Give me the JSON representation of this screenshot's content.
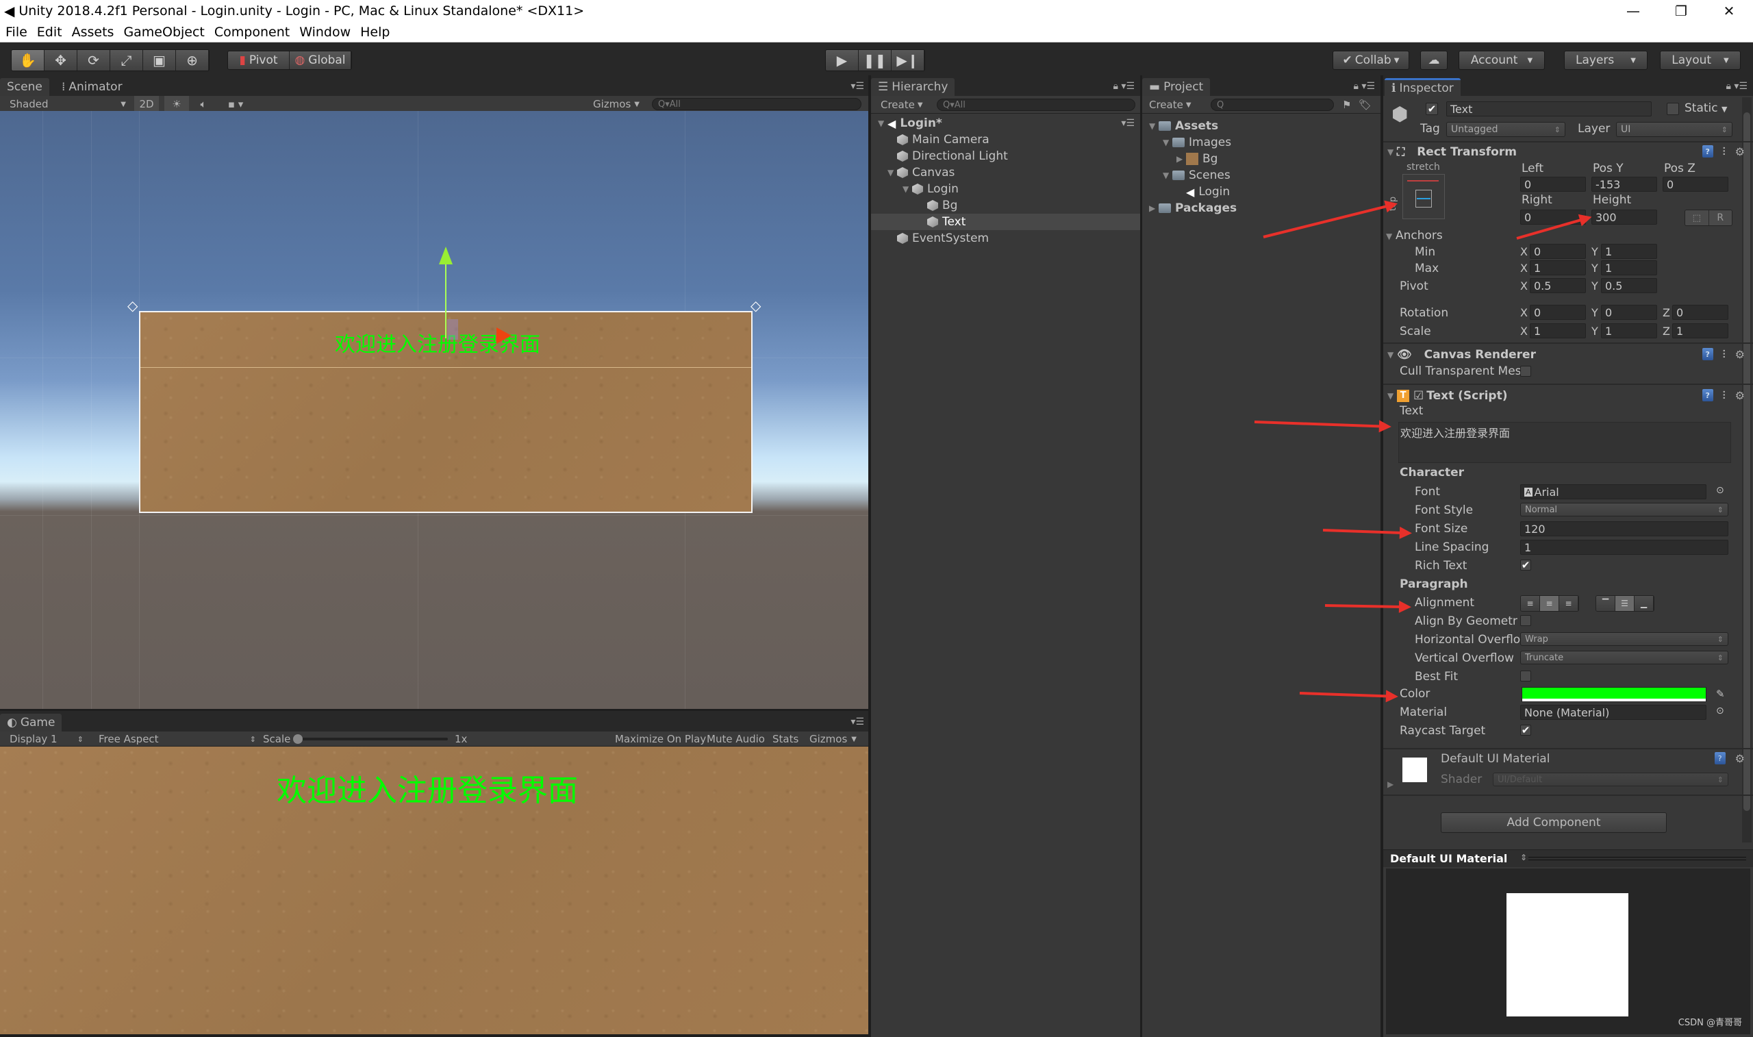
{
  "window": {
    "title": "Unity 2018.4.2f1 Personal - Login.unity - Login - PC, Mac & Linux Standalone* <DX11>",
    "controls": [
      "minimize",
      "restore",
      "close"
    ]
  },
  "menu": [
    "File",
    "Edit",
    "Assets",
    "GameObject",
    "Component",
    "Window",
    "Help"
  ],
  "toolbar": {
    "tools": [
      "hand-tool",
      "move-tool",
      "rotate-tool",
      "scale-tool",
      "rect-tool",
      "transform-tool"
    ],
    "active_tool": "hand-tool",
    "pivot_label": "Pivot",
    "global_label": "Global",
    "collab_label": "Collab",
    "account_label": "Account",
    "layers_label": "Layers",
    "layout_label": "Layout"
  },
  "scene": {
    "tabs": [
      "Scene",
      "Animator"
    ],
    "shading": "Shaded",
    "mode_2d": "2D",
    "gizmos": "Gizmos",
    "search_placeholder": "All",
    "overlay_text": "欢迎进入注册登录界面"
  },
  "game": {
    "tab": "Game",
    "display": "Display 1",
    "aspect": "Free Aspect",
    "scale_label": "Scale",
    "scale_value": "1x",
    "maximize_on_play": "Maximize On Play",
    "mute_audio": "Mute Audio",
    "stats": "Stats",
    "gizmos": "Gizmos",
    "text": "欢迎进入注册登录界面"
  },
  "hierarchy": {
    "tab": "Hierarchy",
    "create_label": "Create",
    "search_placeholder": "All",
    "scene_name": "Login*",
    "items": [
      {
        "label": "Main Camera",
        "depth": 1,
        "expanded": null,
        "selected": false
      },
      {
        "label": "Directional Light",
        "depth": 1,
        "expanded": null,
        "selected": false
      },
      {
        "label": "Canvas",
        "depth": 1,
        "expanded": true,
        "selected": false
      },
      {
        "label": "Login",
        "depth": 2,
        "expanded": true,
        "selected": false
      },
      {
        "label": "Bg",
        "depth": 3,
        "expanded": null,
        "selected": false
      },
      {
        "label": "Text",
        "depth": 3,
        "expanded": null,
        "selected": true
      },
      {
        "label": "EventSystem",
        "depth": 1,
        "expanded": null,
        "selected": false
      }
    ]
  },
  "project": {
    "tab": "Project",
    "create_label": "Create",
    "items": [
      {
        "label": "Assets",
        "depth": 0,
        "type": "folder",
        "bold": true
      },
      {
        "label": "Images",
        "depth": 1,
        "type": "folder",
        "bold": false
      },
      {
        "label": "Bg",
        "depth": 2,
        "type": "texture",
        "bold": false
      },
      {
        "label": "Scenes",
        "depth": 1,
        "type": "folder",
        "bold": false
      },
      {
        "label": "Login",
        "depth": 2,
        "type": "scene",
        "bold": false
      },
      {
        "label": "Packages",
        "depth": 0,
        "type": "folder",
        "bold": true
      }
    ]
  },
  "inspector": {
    "tab": "Inspector",
    "object_name": "Text",
    "active": true,
    "static_label": "Static",
    "tag_label": "Tag",
    "tag_value": "Untagged",
    "layer_label": "Layer",
    "layer_value": "UI",
    "rect_transform": {
      "title": "Rect Transform",
      "preset_h": "stretch",
      "preset_v": "top",
      "col_labels": [
        "Left",
        "Pos Y",
        "Pos Z"
      ],
      "row1": [
        "0",
        "-153",
        "0"
      ],
      "col_labels2": [
        "Right",
        "Height"
      ],
      "row2": [
        "0",
        "300"
      ],
      "r_button": "R",
      "anchors_label": "Anchors",
      "min_label": "Min",
      "min": {
        "x": "0",
        "y": "1"
      },
      "max_label": "Max",
      "max": {
        "x": "1",
        "y": "1"
      },
      "pivot_label": "Pivot",
      "pivot": {
        "x": "0.5",
        "y": "0.5"
      },
      "rotation_label": "Rotation",
      "rotation": {
        "x": "0",
        "y": "0",
        "z": "0"
      },
      "scale_label": "Scale",
      "scale": {
        "x": "1",
        "y": "1",
        "z": "1"
      }
    },
    "canvas_renderer": {
      "title": "Canvas Renderer",
      "cull_label": "Cull Transparent Mes",
      "cull": false
    },
    "text_script": {
      "title": "Text (Script)",
      "text_label": "Text",
      "text_value": "欢迎进入注册登录界面",
      "character_label": "Character",
      "font_label": "Font",
      "font_value": "Arial",
      "font_style_label": "Font Style",
      "font_style_value": "Normal",
      "font_size_label": "Font Size",
      "font_size_value": "120",
      "line_spacing_label": "Line Spacing",
      "line_spacing_value": "1",
      "rich_text_label": "Rich Text",
      "rich_text": true,
      "paragraph_label": "Paragraph",
      "alignment_label": "Alignment",
      "alignment_h": "center",
      "alignment_v": "middle",
      "align_geom_label": "Align By Geometr",
      "align_geom": false,
      "h_overflow_label": "Horizontal Overflo",
      "h_overflow_value": "Wrap",
      "v_overflow_label": "Vertical Overflow",
      "v_overflow_value": "Truncate",
      "best_fit_label": "Best Fit",
      "best_fit": false,
      "color_label": "Color",
      "color_value": "#00ff00",
      "material_label": "Material",
      "material_value": "None (Material)",
      "raycast_label": "Raycast Target",
      "raycast": true
    },
    "material": {
      "title": "Default UI Material",
      "shader_label": "Shader",
      "shader_value": "UI/Default"
    },
    "add_component": "Add Component",
    "preview_title": "Default UI Material"
  },
  "watermark": "CSDN @青哥哥",
  "colors": {
    "text_green": "#00ff00",
    "annotation_red": "#e8302a",
    "inspector_accent": "#3a72c8"
  }
}
